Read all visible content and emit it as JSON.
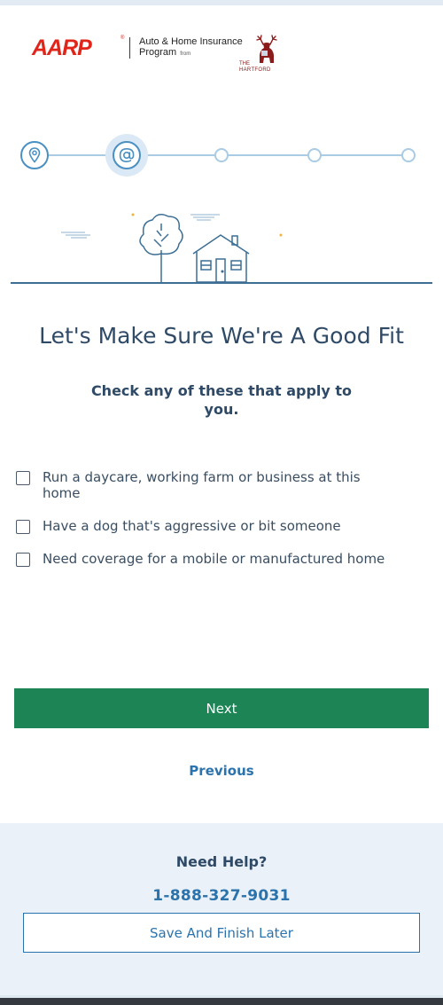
{
  "brand": {
    "aarp": "AARP",
    "aarp_reg": "®",
    "program_line1": "Auto & Home Insurance",
    "program_line2": "Program",
    "program_from": "from",
    "hartford_the": "THE",
    "hartford_name": "HARTFORD",
    "aarp_color": "#e0261b",
    "hartford_color": "#8c1b1b"
  },
  "stepper": {
    "steps": [
      {
        "icon": "location-pin-icon",
        "state": "completed"
      },
      {
        "icon": "at-sign-icon",
        "state": "current"
      },
      {
        "icon": "",
        "state": "upcoming"
      },
      {
        "icon": "",
        "state": "upcoming"
      },
      {
        "icon": "",
        "state": "upcoming"
      }
    ],
    "current_step": 2,
    "total_steps": 5
  },
  "heading": {
    "title": "Let's Make Sure We're A Good Fit",
    "subtitle": "Check any of these that apply to you."
  },
  "options": [
    {
      "label": "Run a daycare, working farm or business at this home",
      "checked": false
    },
    {
      "label": "Have a dog that's aggressive or bit someone",
      "checked": false
    },
    {
      "label": "Need coverage for a mobile or manufactured home",
      "checked": false
    }
  ],
  "actions": {
    "next_label": "Next",
    "previous_label": "Previous",
    "primary_color": "#1d8555",
    "link_color": "#2b73ad"
  },
  "help": {
    "title": "Need Help?",
    "phone": "1-888-327-9031",
    "save_label": "Save And Finish Later"
  }
}
